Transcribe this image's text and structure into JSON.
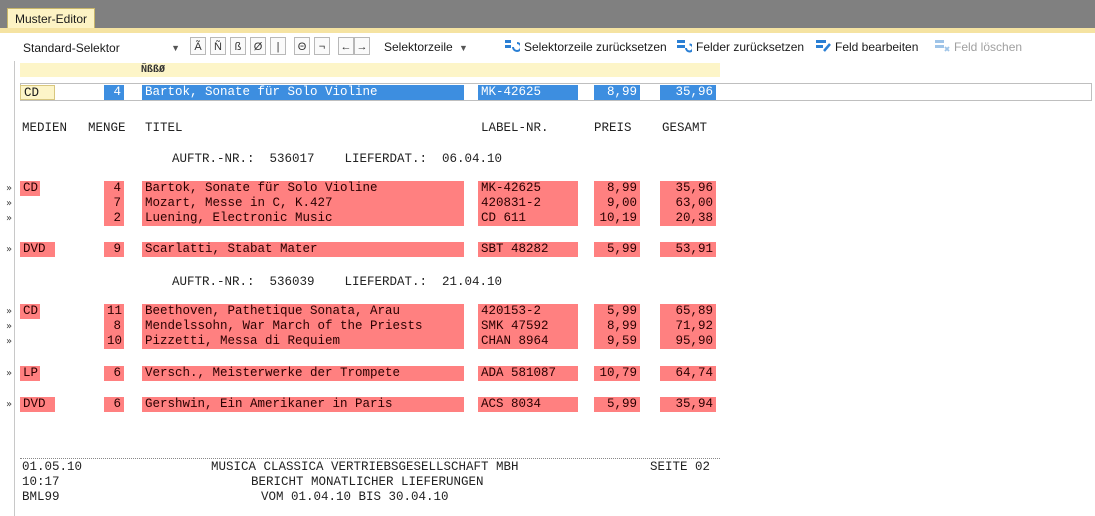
{
  "window": {
    "tab_title": "Muster-Editor"
  },
  "toolbar": {
    "selector_value": "Standard-Selektor",
    "char_buttons": [
      "Ã",
      "Ñ",
      "ß",
      "Ø",
      "|",
      "Θ",
      "¬"
    ],
    "nav_left": "←",
    "nav_right": "→",
    "selektorzeile_label": "Selektorzeile",
    "reset_selektorzeile": "Selektorzeile zurücksetzen",
    "reset_fields": "Felder zurücksetzen",
    "edit_field": "Feld bearbeiten",
    "delete_field": "Feld löschen"
  },
  "header_chars": "ÑßßØ",
  "selector_row": {
    "media": "CD",
    "qty": "4",
    "title": "Bartok, Sonate für Solo Violine",
    "label": "MK-42625",
    "price": "8,99",
    "total": "35,96"
  },
  "columns": {
    "media": "MEDIEN",
    "qty": "MENGE",
    "title": "TITEL",
    "label": "LABEL-NR.",
    "price": "PREIS",
    "total": "GESAMT"
  },
  "orders": [
    {
      "text": "AUFTR.-NR.:  536017    LIEFERDAT.:  06.04.10"
    },
    {
      "text": "AUFTR.-NR.:  536039    LIEFERDAT.:  21.04.10"
    }
  ],
  "items": [
    {
      "media": "CD",
      "qty": "4",
      "title": "Bartok, Sonate für Solo Violine",
      "label": "MK-42625",
      "price": "8,99",
      "total": "35,96"
    },
    {
      "media": "",
      "qty": "7",
      "title": "Mozart, Messe in C, K.427",
      "label": "420831-2",
      "price": "9,00",
      "total": "63,00"
    },
    {
      "media": "",
      "qty": "2",
      "title": "Luening, Electronic Music",
      "label": "CD 611",
      "price": "10,19",
      "total": "20,38"
    },
    {
      "media": "DVD",
      "qty": "9",
      "title": "Scarlatti, Stabat Mater",
      "label": "SBT 48282",
      "price": "5,99",
      "total": "53,91"
    },
    {
      "media": "CD",
      "qty": "11",
      "title": "Beethoven, Pathetique Sonata, Arau",
      "label": "420153-2",
      "price": "5,99",
      "total": "65,89"
    },
    {
      "media": "",
      "qty": "8",
      "title": "Mendelssohn, War March of the Priests",
      "label": "SMK 47592",
      "price": "8,99",
      "total": "71,92"
    },
    {
      "media": "",
      "qty": "10",
      "title": "Pizzetti, Messa di Requiem",
      "label": "CHAN 8964",
      "price": "9,59",
      "total": "95,90"
    },
    {
      "media": "LP",
      "qty": "6",
      "title": "Versch., Meisterwerke der Trompete",
      "label": "ADA 581087",
      "price": "10,79",
      "total": "64,74"
    },
    {
      "media": "DVD",
      "qty": "6",
      "title": "Gershwin, Ein Amerikaner in Paris",
      "label": "ACS 8034",
      "price": "5,99",
      "total": "35,94"
    }
  ],
  "footer": {
    "date": "01.05.10",
    "time": "10:17",
    "code": "BML99",
    "company": "MUSICA CLASSICA VERTRIEBSGESELLSCHAFT MBH",
    "report": "BERICHT MONATLICHER LIEFERUNGEN",
    "period": "VOM 01.04.10 BIS 30.04.10",
    "page": "SEITE 02"
  },
  "colors": {
    "field_red": "#ff8080",
    "field_blue": "#3d8ee0",
    "accent_yellow": "#f5e3a2",
    "title_gray": "#808080"
  }
}
